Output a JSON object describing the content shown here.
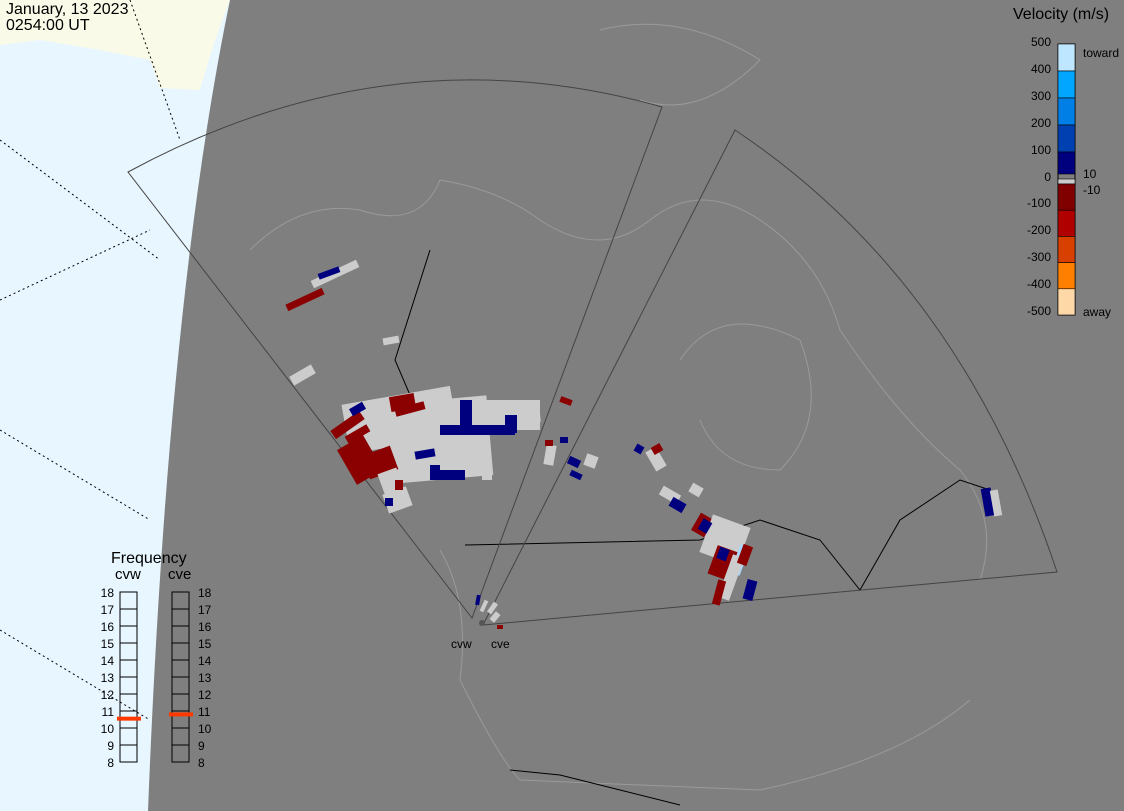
{
  "header": {
    "date": "January, 13 2023",
    "time": "0254:00 UT"
  },
  "velocity_scale": {
    "title": "Velocity (m/s)",
    "ticks": [
      "500",
      "400",
      "300",
      "200",
      "100",
      "0",
      "-100",
      "-200",
      "-300",
      "-400",
      "-500"
    ],
    "toward_label": "toward",
    "away_label": "away",
    "pos_threshold": "10",
    "neg_threshold": "-10",
    "colors": [
      "#bfe6ff",
      "#00a6ff",
      "#0080e6",
      "#0040b0",
      "#00007f",
      "#cccccc",
      "#800000",
      "#b00000",
      "#d84000",
      "#ff8000",
      "#ffd8a8"
    ]
  },
  "frequency": {
    "title": "Frequency",
    "radars": [
      {
        "name": "cvw",
        "value_mhz": 10.55
      },
      {
        "name": "cve",
        "value_mhz": 10.8
      }
    ],
    "ticks": [
      "18",
      "17",
      "16",
      "15",
      "14",
      "13",
      "12",
      "11",
      "10",
      "9",
      "8"
    ],
    "range": [
      8,
      18
    ],
    "marker_color": "#ff3a00"
  },
  "radar_labels": {
    "cvw": "cvw",
    "cve": "cve"
  },
  "colors": {
    "night": "#7f7f7f",
    "day_ocean": "#e8f6ff",
    "day_land": "#fafae8",
    "ground_scatter": "#cccccc"
  }
}
